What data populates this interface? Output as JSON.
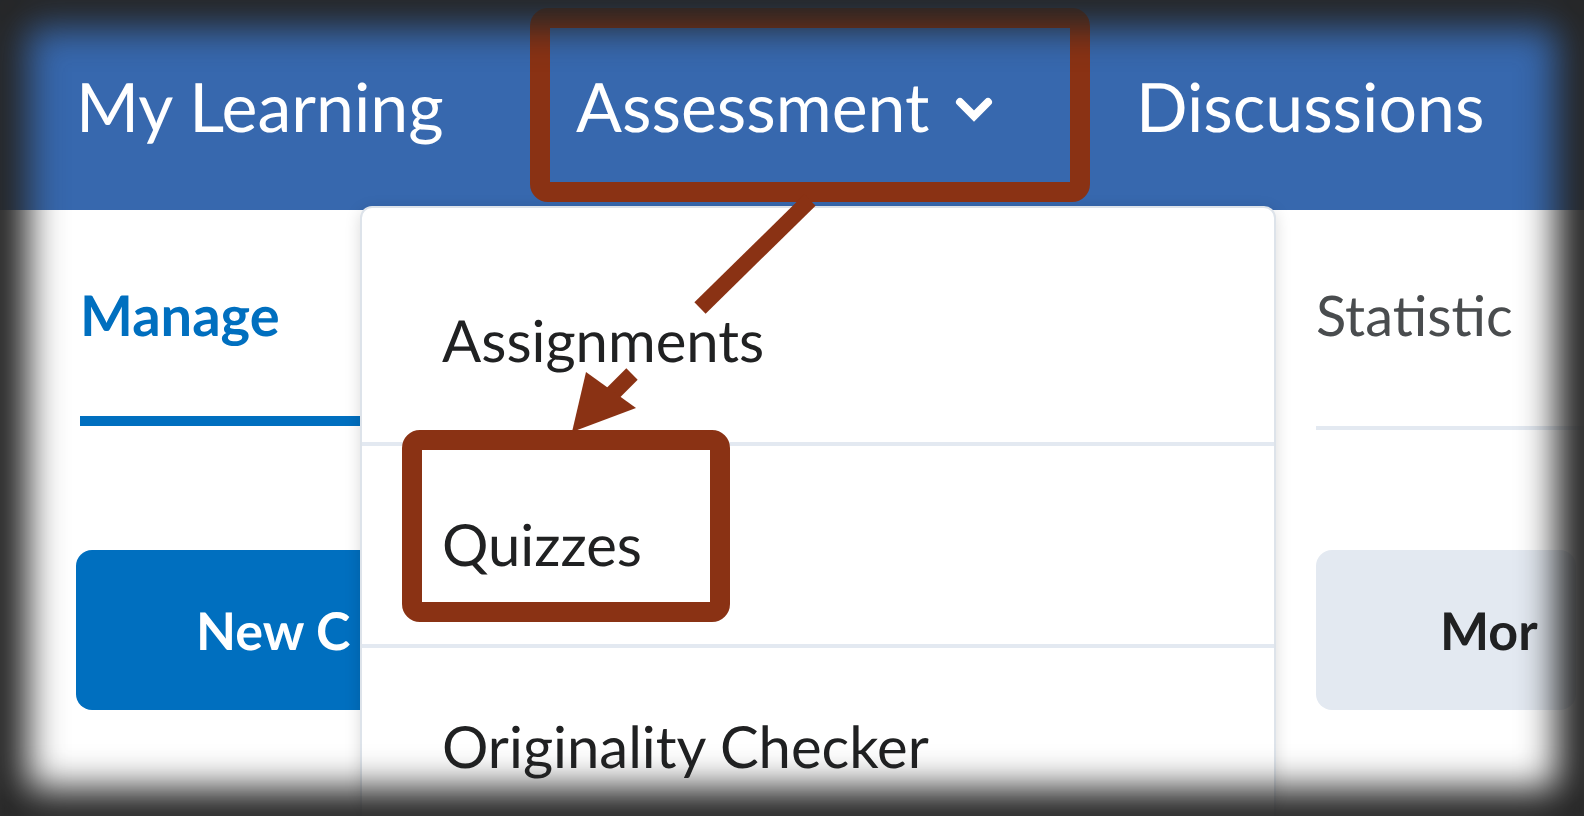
{
  "nav": {
    "items": [
      {
        "label": "My Learning",
        "expanded": false
      },
      {
        "label": "Assessment",
        "expanded": true
      },
      {
        "label": "Discussions",
        "expanded": false
      }
    ]
  },
  "tabs": [
    {
      "label": "Manage",
      "selected": true
    },
    {
      "label": "Statistic",
      "selected": false
    }
  ],
  "buttons": [
    {
      "label": "New C",
      "kind": "primary"
    },
    {
      "label": "Mor",
      "kind": "secondary"
    }
  ],
  "menu": {
    "items": [
      {
        "label": "Assignments"
      },
      {
        "label": "Quizzes"
      },
      {
        "label": "Originality Checker"
      }
    ]
  }
}
